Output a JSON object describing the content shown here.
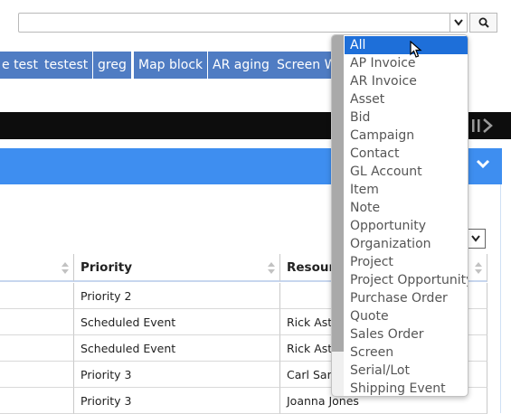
{
  "search": {
    "value": "",
    "dropdown_icon": "chevron-down-icon",
    "go_icon": "search-icon"
  },
  "tabs": [
    {
      "label": "e test"
    },
    {
      "label": "testest"
    },
    {
      "label": "greg"
    },
    {
      "label": "Map block"
    },
    {
      "label": "AR aging"
    },
    {
      "label": "Screen W"
    }
  ],
  "grid": {
    "headers": [
      {
        "label": ""
      },
      {
        "label": "Priority"
      },
      {
        "label": "Resour"
      }
    ],
    "rows": [
      {
        "c0": "",
        "priority": "Priority 2",
        "resource": ""
      },
      {
        "c0": "",
        "priority": "Scheduled Event",
        "resource": "Rick Astl"
      },
      {
        "c0": "",
        "priority": "Scheduled Event",
        "resource": "Rick Astl"
      },
      {
        "c0": "",
        "priority": "Priority 3",
        "resource": "Carl Sam"
      },
      {
        "c0": "",
        "priority": "Priority 3",
        "resource": "Joanna Jones"
      }
    ]
  },
  "dropdown": {
    "selected": "All",
    "options": [
      "All",
      "AP Invoice",
      "AR Invoice",
      "Asset",
      "Bid",
      "Campaign",
      "Contact",
      "GL Account",
      "Item",
      "Note",
      "Opportunity",
      "Organization",
      "Project",
      "Project Opportunity",
      "Purchase Order",
      "Quote",
      "Sales Order",
      "Screen",
      "Serial/Lot",
      "Shipping Event"
    ]
  },
  "colors": {
    "tab_bg": "#4f7cc3",
    "header_blue": "#3e8ef0",
    "selected_blue": "#1e6fd9"
  }
}
